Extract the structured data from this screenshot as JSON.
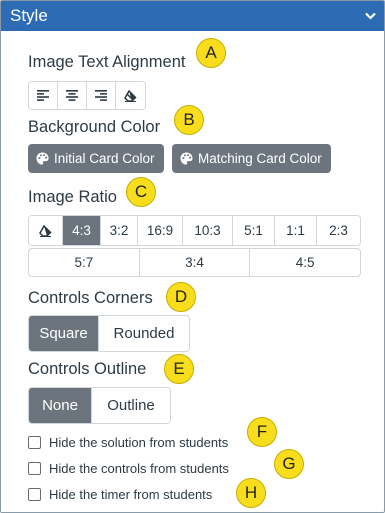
{
  "header": {
    "title": "Style",
    "chevron_icon": "chevron-down-icon"
  },
  "sections": {
    "image_text_alignment": {
      "label": "Image Text Alignment",
      "callout": "A",
      "buttons": [
        "align-left-icon",
        "align-center-icon",
        "align-right-icon",
        "eraser-icon"
      ]
    },
    "background_color": {
      "label": "Background Color",
      "callout": "B",
      "buttons": [
        {
          "label": "Initial Card Color",
          "icon": "palette-icon"
        },
        {
          "label": "Matching Card Color",
          "icon": "palette-icon"
        }
      ]
    },
    "image_ratio": {
      "label": "Image Ratio",
      "callout": "C",
      "row1": [
        "4:3",
        "3:2",
        "16:9",
        "10:3",
        "5:1",
        "1:1",
        "2:3"
      ],
      "row2": [
        "5:7",
        "3:4",
        "4:5"
      ],
      "selected": "4:3"
    },
    "controls_corners": {
      "label": "Controls Corners",
      "callout": "D",
      "options": [
        "Square",
        "Rounded"
      ],
      "selected": "Square"
    },
    "controls_outline": {
      "label": "Controls Outline",
      "callout": "E",
      "options": [
        "None",
        "Outline"
      ],
      "selected": "None"
    },
    "checkboxes": [
      {
        "label": "Hide the solution from students",
        "checked": false,
        "callout": "F"
      },
      {
        "label": "Hide the controls from students",
        "checked": false,
        "callout": "G"
      },
      {
        "label": "Hide the timer from students",
        "checked": false,
        "callout": "H"
      }
    ]
  },
  "colors": {
    "header": "#2d6cb5",
    "active_button": "#6c757d",
    "callout": "#f8dd1c",
    "text": "#2d3b45"
  }
}
